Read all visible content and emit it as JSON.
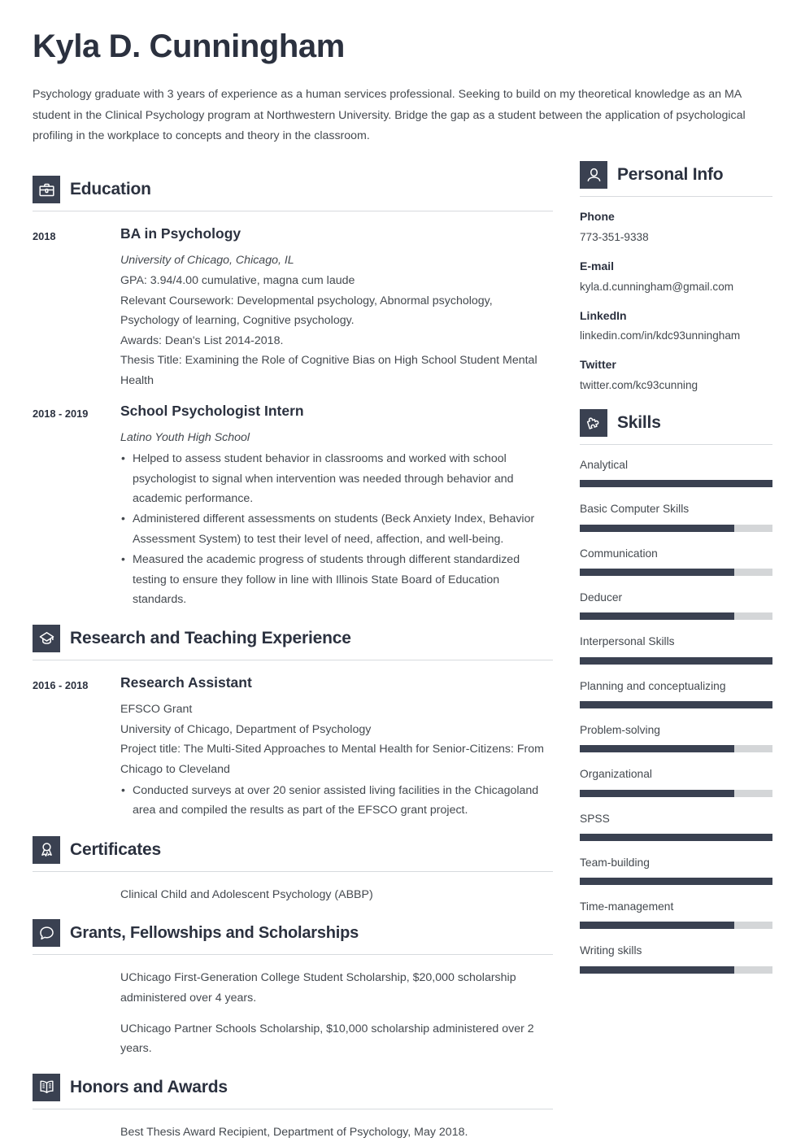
{
  "header": {
    "name": "Kyla D. Cunningham",
    "summary": "Psychology graduate with 3 years of experience as a human services professional. Seeking to build on my theoretical knowledge as an MA student in the Clinical Psychology program at Northwestern University. Bridge the gap as a student between the application of psychological profiling in the workplace to concepts and theory in the classroom."
  },
  "colors": {
    "accent_dark": "#3a4151",
    "heading": "#2b313f",
    "body_text": "#44494f",
    "rule": "#d7dade",
    "track": "#d4d6d8"
  },
  "sections": {
    "education": {
      "title": "Education",
      "icon": "briefcase-icon",
      "entries": [
        {
          "date": "2018",
          "title": "BA in Psychology",
          "subtitle": "University of Chicago, Chicago, IL",
          "lines": [
            "GPA: 3.94/4.00 cumulative, magna cum laude",
            "Relevant Coursework: Developmental psychology, Abnormal psychology, Psychology of learning, Cognitive psychology.",
            "Awards: Dean's List 2014-2018.",
            "Thesis Title: Examining the Role of Cognitive Bias on High School Student Mental Health"
          ],
          "bullets": []
        },
        {
          "date": "2018 - 2019",
          "title": "School Psychologist Intern",
          "subtitle": "Latino Youth High School",
          "lines": [],
          "bullets": [
            "Helped to assess student behavior in classrooms and worked with school psychologist to signal when intervention was needed through behavior and academic performance.",
            "Administered different assessments on students (Beck Anxiety Index, Behavior Assessment System) to test their level of need, affection, and well-being.",
            "Measured the academic progress of students through different standardized testing to ensure they follow in line with Illinois State Board of Education standards."
          ]
        }
      ]
    },
    "research": {
      "title": "Research and Teaching Experience",
      "icon": "graduation-cap-icon",
      "entries": [
        {
          "date": "2016 - 2018",
          "title": "Research Assistant",
          "subtitle": "",
          "lines": [
            "EFSCO Grant",
            "University of Chicago, Department of Psychology",
            "Project title: The Multi-Sited Approaches to Mental Health for Senior-Citizens: From Chicago to Cleveland"
          ],
          "bullets": [
            "Conducted surveys at over 20 senior assisted living facilities in the Chicagoland area and compiled the results as part of the EFSCO grant project."
          ]
        }
      ]
    },
    "certificates": {
      "title": "Certificates",
      "icon": "award-ribbon-icon",
      "items": [
        "Clinical Child and Adolescent Psychology (ABBP)"
      ]
    },
    "grants": {
      "title": "Grants, Fellowships and Scholarships",
      "icon": "speech-bubble-icon",
      "items": [
        "UChicago First-Generation College Student Scholarship, $20,000 scholarship administered over 4 years.",
        "UChicago Partner Schools Scholarship, $10,000 scholarship administered over 2 years."
      ]
    },
    "honors": {
      "title": "Honors and Awards",
      "icon": "open-book-icon",
      "items": [
        "Best Thesis Award Recipient, Department of Psychology, May 2018."
      ]
    },
    "personal_info": {
      "title": "Personal Info",
      "icon": "person-icon",
      "fields": [
        {
          "label": "Phone",
          "value": "773-351-9338"
        },
        {
          "label": "E-mail",
          "value": "kyla.d.cunningham@gmail.com"
        },
        {
          "label": "LinkedIn",
          "value": "linkedin.com/in/kdc93unningham"
        },
        {
          "label": "Twitter",
          "value": "twitter.com/kc93cunning"
        }
      ]
    },
    "skills": {
      "title": "Skills",
      "icon": "puzzle-piece-icon",
      "items": [
        {
          "name": "Analytical",
          "level": 100
        },
        {
          "name": "Basic Computer Skills",
          "level": 80
        },
        {
          "name": "Communication",
          "level": 80
        },
        {
          "name": "Deducer",
          "level": 80
        },
        {
          "name": "Interpersonal Skills",
          "level": 100
        },
        {
          "name": "Planning and conceptualizing",
          "level": 100
        },
        {
          "name": "Problem-solving",
          "level": 80
        },
        {
          "name": "Organizational",
          "level": 80
        },
        {
          "name": "SPSS",
          "level": 100
        },
        {
          "name": "Team-building",
          "level": 100
        },
        {
          "name": "Time-management",
          "level": 80
        },
        {
          "name": "Writing skills",
          "level": 80
        }
      ]
    }
  }
}
